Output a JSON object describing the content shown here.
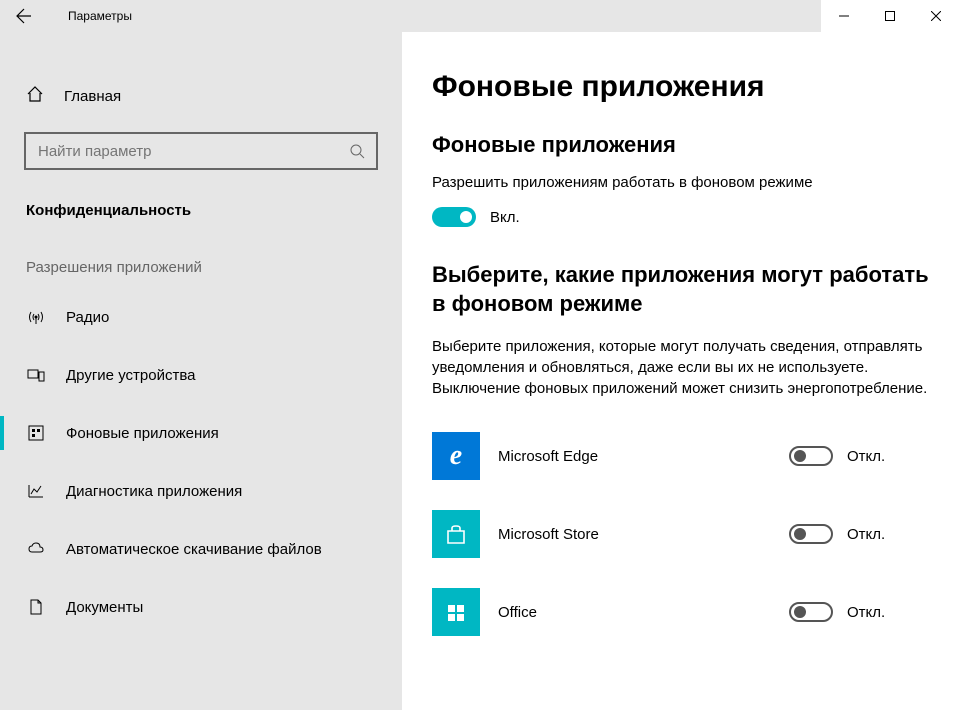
{
  "window": {
    "title": "Параметры"
  },
  "sidebar": {
    "home": "Главная",
    "search_placeholder": "Найти параметр",
    "section_label": "Конфиденциальность",
    "group_label": "Разрешения приложений",
    "items": [
      {
        "label": "Радио"
      },
      {
        "label": "Другие устройства"
      },
      {
        "label": "Фоновые приложения"
      },
      {
        "label": "Диагностика приложения"
      },
      {
        "label": "Автоматическое скачивание файлов"
      },
      {
        "label": "Документы"
      }
    ]
  },
  "main": {
    "page_title": "Фоновые приложения",
    "section1_title": "Фоновые приложения",
    "master_label": "Разрешить приложениям работать в фоновом режиме",
    "master_state_label": "Вкл.",
    "section2_title": "Выберите, какие приложения могут работать в фоновом режиме",
    "section2_desc": "Выберите приложения, которые могут получать сведения, отправлять уведомления и обновляться, даже если вы их не используете. Выключение фоновых приложений может снизить энергопотребление.",
    "off_label": "Откл.",
    "apps": [
      {
        "name": "Microsoft Edge",
        "state": "Откл.",
        "color": "#0078d7",
        "glyph": "e"
      },
      {
        "name": "Microsoft Store",
        "state": "Откл.",
        "color": "#00b7c3",
        "glyph": "bag"
      },
      {
        "name": "Office",
        "state": "Откл.",
        "color": "#00b7c3",
        "glyph": ""
      }
    ]
  }
}
